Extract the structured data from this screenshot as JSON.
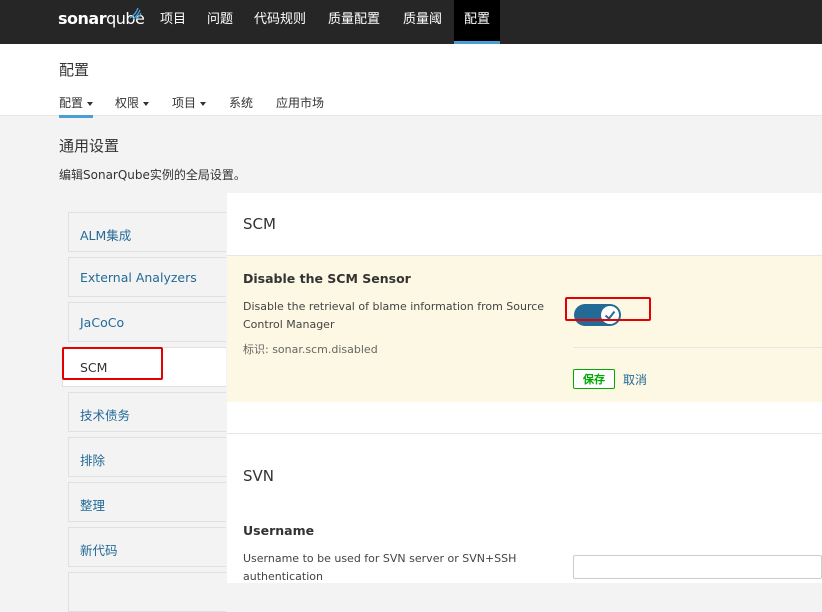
{
  "app": {
    "brand_main": "sonar",
    "brand_sub": "qube"
  },
  "topnav": {
    "items": [
      "项目",
      "问题",
      "代码规则",
      "质量配置",
      "质量阈",
      "配置"
    ],
    "active": "配置"
  },
  "header": {
    "title": "配置",
    "tabs": [
      "配置",
      "权限",
      "项目",
      "系统",
      "应用市场"
    ]
  },
  "general": {
    "title": "通用设置",
    "description": "编辑SonarQube实例的全局设置。"
  },
  "categories": [
    "ALM集成",
    "External Analyzers",
    "JaCoCo",
    "SCM",
    "技术债务",
    "排除",
    "整理",
    "新代码"
  ],
  "selected_category": "SCM",
  "scm": {
    "section_title": "SCM",
    "setting_name": "Disable the SCM Sensor",
    "setting_desc_line1": "Disable the retrieval of blame information from Source",
    "setting_desc_line2": "Control Manager",
    "setting_key": "标识: sonar.scm.disabled",
    "toggle_on": true,
    "save_label": "保存",
    "cancel_label": "取消"
  },
  "svn": {
    "section_title": "SVN",
    "username_label": "Username",
    "username_desc_line1": "Username to be used for SVN server or SVN+SSH",
    "username_desc_line2": "authentication",
    "username_value": ""
  },
  "colors": {
    "accent": "#4b9fd5",
    "link": "#236a97",
    "nav_bg": "#262626",
    "highlight_bg": "#fcf8e3",
    "annotation": "#e30000",
    "save_green": "#00aa00"
  }
}
